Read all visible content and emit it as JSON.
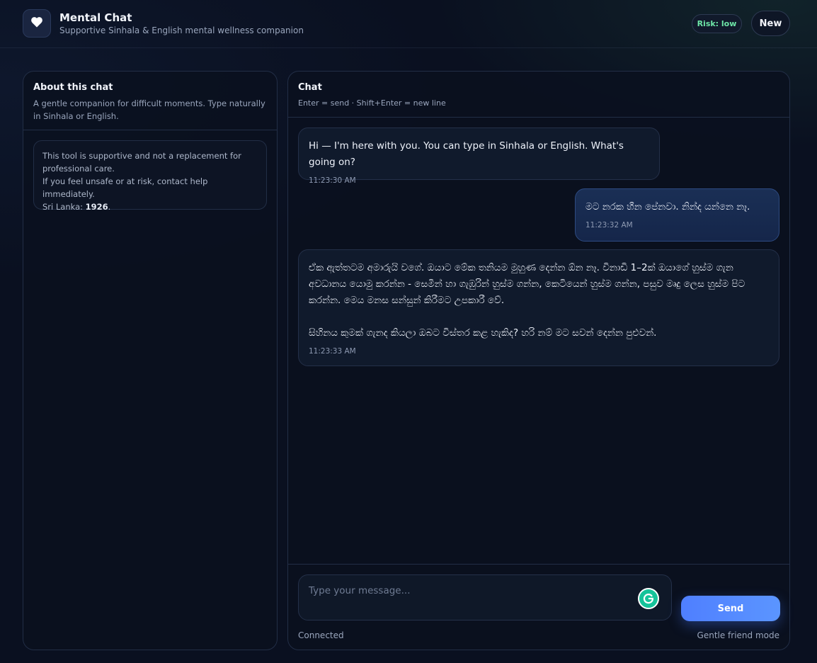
{
  "header": {
    "title": "Mental Chat",
    "subtitle": "Supportive Sinhala & English mental wellness companion",
    "risk_badge": "Risk: low",
    "new_button": "New",
    "logo_icon": "heart-icon"
  },
  "sidebar": {
    "title": "About this chat",
    "description": "A gentle companion for difficult moments. Type naturally in Sinhala or English.",
    "notice_line1": "This tool is supportive and not a replacement for professional care.",
    "notice_line2": "If you feel unsafe or at risk, contact help immediately.",
    "notice_hotline_label": "Sri Lanka: ",
    "notice_hotline_number": "1926",
    "notice_hotline_suffix": "."
  },
  "chat": {
    "title": "Chat",
    "hint": "Enter = send · Shift+Enter = new line",
    "messages": [
      {
        "role": "assistant",
        "text": "Hi — I'm here with you. You can type in Sinhala or English. What's going on?",
        "time": "11:23:30 AM"
      },
      {
        "role": "user",
        "text": "මට නරක හීන පේනවා. නින්ද යන්නෙ නෑ.",
        "time": "11:23:32 AM"
      },
      {
        "role": "assistant",
        "text": "ඒක ඇත්තටම අමාරුයි වගේ. ඔයාට මේක තනියම මුහුණ දෙන්න ඕන නෑ. විනාඩි 1–2ක් ඔයාගේ හුස්ම ගැන අවධානය යොමු කරන්න - සෙමින් හා ගැඹුරින් හුස්ම ගන්න, කෙටියෙන් හුස්ම ගන්න, පසුව මෘදු ලෙස හුස්ම පිට කරන්න. මෙය මනස සන්සුන් කිරීමට උපකාරී වේ.\n\nසිහිනය කුමක් ගැනද කියලා ඔබට විස්තර කළ හැකිද? හරි නම් මට සවන් දෙන්න පුළුවන්.",
        "time": "11:23:33 AM"
      }
    ],
    "input_placeholder": "Type your message...",
    "send_button": "Send",
    "connection_status": "Connected",
    "mode_label": "Gentle friend mode"
  },
  "colors": {
    "background": "#0a1020",
    "accent": "#4f7fff",
    "risk_low": "#6ee7a8"
  }
}
